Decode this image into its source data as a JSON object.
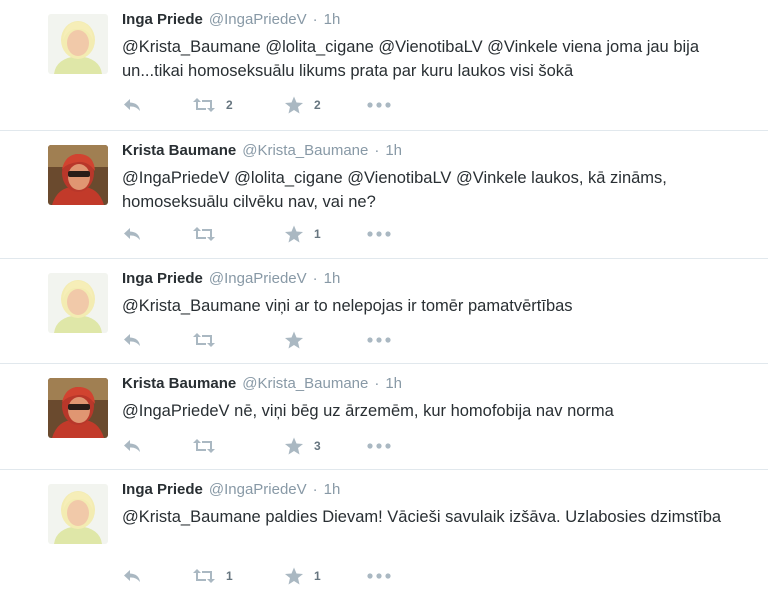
{
  "tweets": [
    {
      "name": "Inga Priede",
      "handle": "@IngaPriedeV",
      "sep": "·",
      "time": "1h",
      "text": "@Krista_Baumane @lolita_cigane @VienotibaLV @Vinkele viena joma jau bija un...tikai homoseksuālu likums prata par kuru laukos visi šokā",
      "retweets": "2",
      "favorites": "2",
      "avatar": "inga"
    },
    {
      "name": "Krista Baumane",
      "handle": "@Krista_Baumane",
      "sep": "·",
      "time": "1h",
      "text": "@IngaPriedeV @lolita_cigane @VienotibaLV @Vinkele laukos, kā zināms, homoseksuālu cilvēku nav, vai ne?",
      "retweets": "",
      "favorites": "1",
      "avatar": "krista"
    },
    {
      "name": "Inga Priede",
      "handle": "@IngaPriedeV",
      "sep": "·",
      "time": "1h",
      "text": "@Krista_Baumane viņi ar to nelepojas ir tomēr pamatvērtības",
      "retweets": "",
      "favorites": "",
      "avatar": "inga"
    },
    {
      "name": "Krista Baumane",
      "handle": "@Krista_Baumane",
      "sep": "·",
      "time": "1h",
      "text": "@IngaPriedeV nē, viņi bēg uz ārzemēm, kur homofobija nav norma",
      "retweets": "",
      "favorites": "3",
      "avatar": "krista"
    },
    {
      "name": "Inga Priede",
      "handle": "@IngaPriedeV",
      "sep": "·",
      "time": "1h",
      "text": "@Krista_Baumane paldies Dievam! Vācieši savulaik izšāva. Uzlabosies dzimstība",
      "retweets": "1",
      "favorites": "1",
      "avatar": "inga"
    }
  ],
  "colors": {
    "icon": "#aab8c2",
    "muted": "#8899a6",
    "border": "#e1e8ed"
  },
  "icons": {
    "reply": "reply-icon",
    "retweet": "retweet-icon",
    "favorite": "star-icon",
    "more": "more-icon"
  }
}
